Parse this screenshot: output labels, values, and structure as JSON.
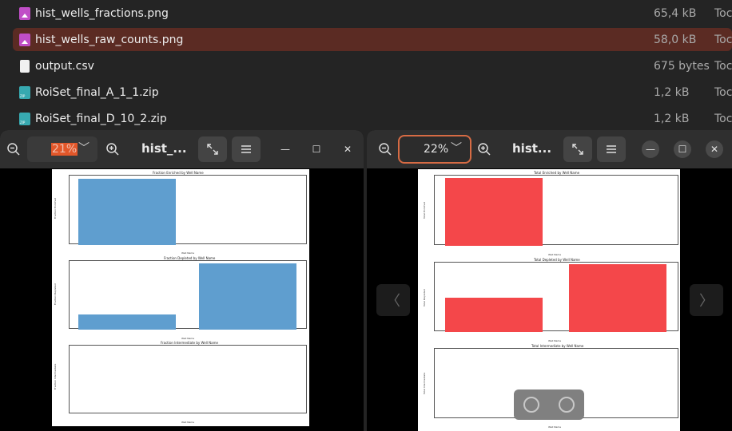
{
  "files": [
    {
      "name": "hist_wells_fractions.png",
      "size": "65,4 kB",
      "date": "Toc",
      "type": "image",
      "selected": false
    },
    {
      "name": "hist_wells_raw_counts.png",
      "size": "58,0 kB",
      "date": "Toc",
      "type": "image",
      "selected": true
    },
    {
      "name": "output.csv",
      "size": "675 bytes",
      "date": "Toc",
      "type": "text",
      "selected": false
    },
    {
      "name": "RoiSet_final_A_1_1.zip",
      "size": "1,2 kB",
      "date": "Toc",
      "type": "zip",
      "selected": false
    },
    {
      "name": "RoiSet_final_D_10_2.zip",
      "size": "1,2 kB",
      "date": "Toc",
      "type": "zip",
      "selected": false
    }
  ],
  "viewer_left": {
    "title": "hist_...",
    "zoom": "21%",
    "plots": [
      {
        "title": "Fraction Enriched by Well Name",
        "ylabel": "Fraction Enriched",
        "xlabel": "Well Name"
      },
      {
        "title": "Fraction Depleted by Well Name",
        "ylabel": "Fraction Depleted",
        "xlabel": "Well Name"
      },
      {
        "title": "Fraction Intermediate by Well Name",
        "ylabel": "Fraction Intermediate",
        "xlabel": "Well Name"
      }
    ]
  },
  "viewer_right": {
    "title": "hist...",
    "zoom": "22%",
    "plots": [
      {
        "title": "Total Enriched by Well Name",
        "ylabel": "Total Enriched",
        "xlabel": "Well Name"
      },
      {
        "title": "Total Depleted by Well Name",
        "ylabel": "Total Depleted",
        "xlabel": "Well Name"
      },
      {
        "title": "Total Intermediate by Well Name",
        "ylabel": "Total Intermediate",
        "xlabel": "Well Name"
      }
    ]
  },
  "icons": {
    "zoom_out": "zoom-out-icon",
    "zoom_in": "zoom-in-icon",
    "fullscreen": "fullscreen-icon",
    "menu": "hamburger-menu-icon",
    "minimize": "minimize-icon",
    "maximize": "maximize-icon",
    "close": "close-icon",
    "prev": "chevron-left-icon",
    "next": "chevron-right-icon",
    "rotate_left": "rotate-left-icon",
    "rotate_right": "rotate-right-icon"
  },
  "colors": {
    "selected_row": "#5b2b23",
    "bar_blue": "#5f9ecf",
    "bar_red": "#f4474a",
    "zoom_focus": "#d66b44"
  }
}
